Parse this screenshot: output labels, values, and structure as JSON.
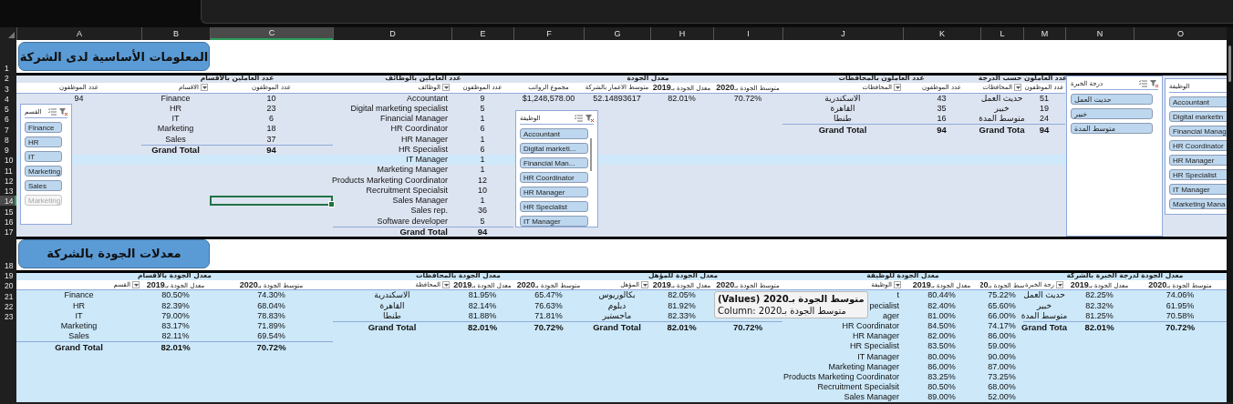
{
  "column_headers": [
    {
      "label": "O",
      "selected": false
    },
    {
      "label": "N",
      "selected": false
    },
    {
      "label": "M",
      "selected": false
    },
    {
      "label": "L",
      "selected": false
    },
    {
      "label": "K",
      "selected": false
    },
    {
      "label": "J",
      "selected": false
    },
    {
      "label": "I",
      "selected": false
    },
    {
      "label": "H",
      "selected": false
    },
    {
      "label": "G",
      "selected": false
    },
    {
      "label": "F",
      "selected": false
    },
    {
      "label": "E",
      "selected": false
    },
    {
      "label": "D",
      "selected": false
    },
    {
      "label": "C",
      "selected": true
    },
    {
      "label": "B",
      "selected": false
    },
    {
      "label": "A",
      "selected": false
    }
  ],
  "row_headers": [
    {
      "label": "1",
      "selected": false
    },
    {
      "label": "2",
      "selected": false
    },
    {
      "label": "3",
      "selected": false
    },
    {
      "label": "4",
      "selected": false
    },
    {
      "label": "5",
      "selected": false
    },
    {
      "label": "6",
      "selected": false
    },
    {
      "label": "7",
      "selected": false
    },
    {
      "label": "8",
      "selected": false
    },
    {
      "label": "9",
      "selected": false
    },
    {
      "label": "10",
      "selected": false
    },
    {
      "label": "11",
      "selected": false
    },
    {
      "label": "12",
      "selected": false
    },
    {
      "label": "13",
      "selected": false
    },
    {
      "label": "14",
      "selected": true
    },
    {
      "label": "15",
      "selected": false
    },
    {
      "label": "16",
      "selected": false
    },
    {
      "label": "17",
      "selected": false
    },
    {
      "label": "18",
      "selected": false
    },
    {
      "label": "19",
      "selected": false
    },
    {
      "label": "20",
      "selected": false
    },
    {
      "label": "21",
      "selected": false
    },
    {
      "label": "22",
      "selected": false
    },
    {
      "label": "23",
      "selected": false
    }
  ],
  "sections": [
    {
      "title": "المعلومات الأساسية لدى الشركة",
      "pivots": [
        {
          "title": "عدد العاملون حسب الدرجة",
          "columns": [
            {
              "label": "عدد الموظفون",
              "filter": false
            },
            {
              "label": "المحافظات",
              "filter": true
            }
          ],
          "rows": [
            [
              "51",
              "حديث العمل"
            ],
            [
              "19",
              "خبير"
            ],
            [
              "24",
              "متوسط المدة"
            ]
          ],
          "total": [
            "94",
            "Grand Tota"
          ]
        },
        {
          "title": "عدد العاملون بالمحافظات",
          "columns": [
            {
              "label": "عدد الموظفون",
              "filter": false
            },
            {
              "label": "المحافظات",
              "filter": true
            }
          ],
          "rows": [
            [
              "43",
              "الاسكندرية"
            ],
            [
              "35",
              "القاهرة"
            ],
            [
              "16",
              "طنطا"
            ]
          ],
          "total": [
            "94",
            "Grand Total"
          ]
        },
        {
          "title": "معدل الجودة",
          "columns": [
            {
              "label": "متوسط الجودة بـ**2020**",
              "filter": false
            },
            {
              "label": "معدل الجودة بـ**2019**",
              "filter": false
            },
            {
              "label": "متوسط الاعمار بالشركة",
              "filter": false
            },
            {
              "label": "مجموع الرواتب",
              "filter": false
            }
          ],
          "rows": [
            [
              "70.72%",
              "82.01%",
              "52.14893617",
              "$1,248,578.00"
            ]
          ]
        },
        {
          "title": "عدد العاملين بالوظائف",
          "columns": [
            {
              "label": "عدد الموظفون",
              "filter": false
            },
            {
              "label": "الوظائف",
              "filter": true
            }
          ],
          "rows": [
            [
              "9",
              "Accountant"
            ],
            [
              "5",
              "Digital marketing specialist"
            ],
            [
              "1",
              "Financial Manager"
            ],
            [
              "6",
              "HR Coordinator"
            ],
            [
              "1",
              "HR Manager"
            ],
            [
              "6",
              "HR Specialist"
            ],
            [
              "1",
              "IT Manager"
            ],
            [
              "1",
              "Marketing Manager"
            ],
            [
              "12",
              "Products Marketing Coordinator"
            ],
            [
              "10",
              "Recruitment Specialsit"
            ],
            [
              "1",
              "Sales Manager"
            ],
            [
              "36",
              "Sales rep."
            ],
            [
              "5",
              "Software developer"
            ]
          ],
          "total": [
            "94",
            "Grand Total"
          ]
        },
        {
          "title": "عدد العاملين بالاقسام",
          "columns": [
            {
              "label": "عدد الموظفون",
              "filter": false
            },
            {
              "label": "الاقسام",
              "filter": true
            }
          ],
          "rows": [
            [
              "10",
              "Finance"
            ],
            [
              "23",
              "HR"
            ],
            [
              "6",
              "IT"
            ],
            [
              "18",
              "Marketing"
            ],
            [
              "37",
              "Sales"
            ]
          ],
          "total": [
            "94",
            "Grand Total"
          ]
        },
        {
          "columns": [
            {
              "label": "عدد الموظفون",
              "filter": false
            }
          ],
          "rows": [
            [
              "94"
            ]
          ]
        }
      ],
      "slicers": [
        {
          "title": "الوظيفة",
          "items": [
            {
              "label": "Accountant",
              "selected": true,
              "disabled": false
            },
            {
              "label": "Digital marketin",
              "selected": true,
              "disabled": false
            },
            {
              "label": "Financial Manag",
              "selected": true,
              "disabled": false
            },
            {
              "label": "HR Coordinator",
              "selected": true,
              "disabled": false
            },
            {
              "label": "HR Manager",
              "selected": true,
              "disabled": false
            },
            {
              "label": "HR Specialist",
              "selected": true,
              "disabled": false
            },
            {
              "label": "IT Manager",
              "selected": true,
              "disabled": false
            },
            {
              "label": "Marketing Mana",
              "selected": true,
              "disabled": false
            }
          ]
        },
        {
          "title": "درجة الخبرة",
          "items": [
            {
              "label": "حديث العمل",
              "selected": true,
              "disabled": false
            },
            {
              "label": "خبير",
              "selected": true,
              "disabled": false
            },
            {
              "label": "متوسط المدة",
              "selected": true,
              "disabled": false
            }
          ]
        },
        {
          "title": "الوظيفة",
          "items": [
            {
              "label": "Accountant",
              "selected": true,
              "disabled": false
            },
            {
              "label": "Digital marketi...",
              "selected": true,
              "disabled": false
            },
            {
              "label": "Financial Man...",
              "selected": true,
              "disabled": false
            },
            {
              "label": "HR Coordinator",
              "selected": true,
              "disabled": false
            },
            {
              "label": "HR Manager",
              "selected": true,
              "disabled": false
            },
            {
              "label": "HR Specialist",
              "selected": true,
              "disabled": false
            },
            {
              "label": "IT Manager",
              "selected": true,
              "disabled": false
            }
          ]
        },
        {
          "title": "القسم",
          "items": [
            {
              "label": "Finance",
              "selected": true,
              "disabled": false
            },
            {
              "label": "HR",
              "selected": true,
              "disabled": false
            },
            {
              "label": "IT",
              "selected": true,
              "disabled": false
            },
            {
              "label": "Marketing",
              "selected": true,
              "disabled": false
            },
            {
              "label": "Sales",
              "selected": true,
              "disabled": false
            },
            {
              "label": "Marketing",
              "selected": false,
              "disabled": true
            }
          ]
        }
      ]
    },
    {
      "title": "معدلات الجودة بالشركة",
      "pivots": [
        {
          "title": "معدل الجودة لدرجة الخبرة بالشركة",
          "columns": [
            {
              "label": "متوسط الجودة بـ**2020**",
              "filter": false
            },
            {
              "label": "معدل الجودة بـ**2019**",
              "filter": false
            },
            {
              "label": "رجة الخبرة",
              "filter": true
            }
          ],
          "rows": [
            [
              "74.06%",
              "82.25%",
              "حديث العمل"
            ],
            [
              "61.95%",
              "82.32%",
              "خبير"
            ],
            [
              "70.58%",
              "81.25%",
              "متوسط المدة"
            ]
          ],
          "total": [
            "70.72%",
            "82.01%",
            "Grand Tota"
          ]
        },
        {
          "title": "معدل الجودة للوظيفة",
          "columns": [
            {
              "label": "سط الجودة بـ**20**",
              "filter": false
            },
            {
              "label": "معدل الجودة بـ**2019**",
              "filter": false
            },
            {
              "label": "الوظيفة",
              "filter": true
            }
          ],
          "rows": [
            [
              "75.22%",
              "80.44%",
              "t"
            ],
            [
              "65.60%",
              "82.40%",
              "pecialist"
            ],
            [
              "66.00%",
              "81.00%",
              "ager"
            ],
            [
              "74.17%",
              "84.50%",
              "HR Coordinator"
            ],
            [
              "86.00%",
              "82.00%",
              "HR Manager"
            ],
            [
              "59.00%",
              "83.50%",
              "HR Specialist"
            ],
            [
              "90.00%",
              "80.00%",
              "IT Manager"
            ],
            [
              "87.00%",
              "86.00%",
              "Marketing Manager"
            ],
            [
              "73.25%",
              "83.25%",
              "Products Marketing Coordinator"
            ],
            [
              "68.00%",
              "80.50%",
              "Recruitment Specialsit"
            ],
            [
              "52.00%",
              "89.00%",
              "Sales Manager"
            ]
          ]
        },
        {
          "title": "معدل الجودة للمؤهل",
          "columns": [
            {
              "label": "متوسط الجودة بـ**2020**",
              "filter": false
            },
            {
              "label": "معدل الجودة بـ**2019**",
              "filter": false
            },
            {
              "label": "المؤهل",
              "filter": true
            }
          ],
          "rows": [
            [
              "",
              "82.05%",
              "بكالوريوس"
            ],
            [
              "",
              "81.92%",
              "دبلوم"
            ],
            [
              "",
              "82.33%",
              "ماجستير"
            ]
          ],
          "total": [
            "70.72%",
            "82.01%",
            "Grand Total"
          ]
        },
        {
          "title": "معدل الجودة بالمحافظات",
          "columns": [
            {
              "label": "متوسط الجودة بـ**2020**",
              "filter": false
            },
            {
              "label": "معدل الجودة بـ**2019**",
              "filter": false
            },
            {
              "label": "المحافظة",
              "filter": true
            }
          ],
          "rows": [
            [
              "65.47%",
              "81.95%",
              "الاسكندرية"
            ],
            [
              "76.63%",
              "82.14%",
              "القاهرة"
            ],
            [
              "71.81%",
              "81.88%",
              "طنطا"
            ]
          ],
          "total": [
            "70.72%",
            "82.01%",
            "Grand Total"
          ]
        },
        {
          "title": "معدل الجودة بالاقسام",
          "columns": [
            {
              "label": "متوسط الجودة بـ**2020**",
              "filter": false
            },
            {
              "label": "معدل الجودة بـ**2019**",
              "filter": false
            },
            {
              "label": "القسم",
              "filter": true
            }
          ],
          "rows": [
            [
              "74.30%",
              "80.50%",
              "Finance"
            ],
            [
              "68.04%",
              "82.39%",
              "HR"
            ],
            [
              "78.83%",
              "79.00%",
              "IT"
            ],
            [
              "71.89%",
              "83.17%",
              "Marketing"
            ],
            [
              "69.54%",
              "82.11%",
              "Sales"
            ]
          ],
          "total": [
            "70.72%",
            "82.01%",
            "Grand Total"
          ]
        }
      ]
    }
  ],
  "tooltip": {
    "title": "متوسط الجودة بـ2020 (Values)",
    "detail": "Column: متوسط الجودة بـ2020"
  }
}
